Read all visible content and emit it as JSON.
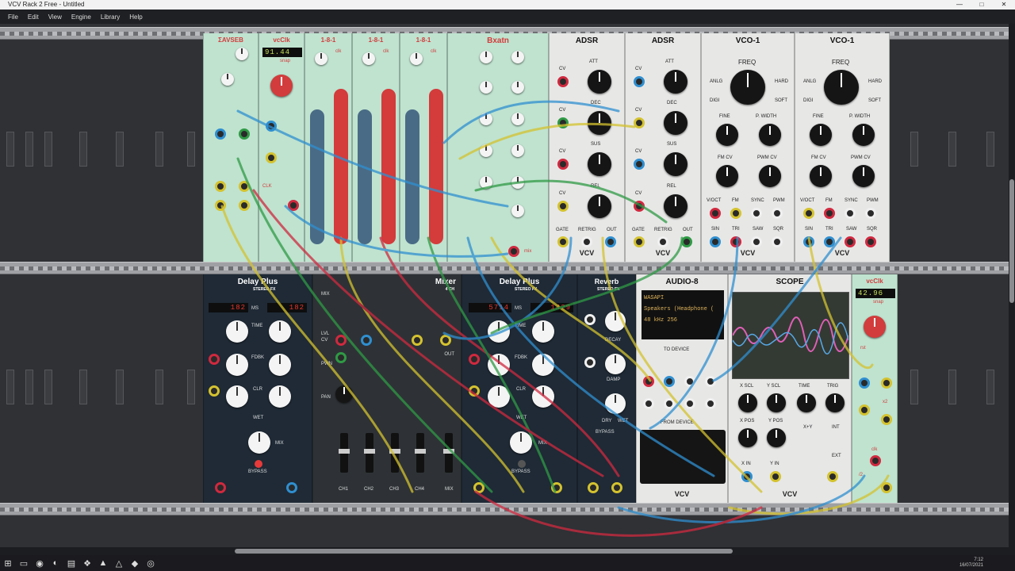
{
  "window": {
    "title": "VCV Rack 2 Free - Untitled",
    "controls": [
      "—",
      "□",
      "✕"
    ]
  },
  "menu": [
    "File",
    "Edit",
    "View",
    "Engine",
    "Library",
    "Help"
  ],
  "top_row": {
    "lfo_mod": {
      "name": "ΣAVSEB"
    },
    "clock1": {
      "name": "vcClk",
      "display": "91.44",
      "snap": "snap",
      "knob_label": "CLK"
    },
    "seq1": {
      "name": "1-8-1",
      "knob": "clk"
    },
    "seq2": {
      "name": "1-8-1",
      "knob": "clk"
    },
    "seq3": {
      "name": "1-8-1",
      "knob": "clk"
    },
    "bxatn": {
      "name": "Bxatn",
      "mix": "mix"
    },
    "adsr1": {
      "name": "ADSR",
      "labels": [
        "ATT",
        "DEC",
        "SUS",
        "REL",
        "CV",
        "CV",
        "CV",
        "CV",
        "GATE",
        "RETRIG",
        "OUT"
      ],
      "logo": "VCV"
    },
    "adsr2": {
      "name": "ADSR",
      "labels": [
        "ATT",
        "DEC",
        "SUS",
        "REL",
        "CV",
        "CV",
        "CV",
        "CV",
        "GATE",
        "RETRIG",
        "OUT"
      ],
      "logo": "VCV"
    },
    "vco1": {
      "name": "VCO-1",
      "freq": "FREQ",
      "anlg": "ANLG",
      "digi": "DIGI",
      "hard": "HARD",
      "soft": "SOFT",
      "fine": "FINE",
      "pwidth": "P. WIDTH",
      "fmcv": "FM CV",
      "pwmcv": "PWM CV",
      "jacks": [
        "V/OCT",
        "FM",
        "SYNC",
        "PWM",
        "SIN",
        "TRI",
        "SAW",
        "SQR"
      ],
      "logo": "VCV"
    },
    "vco2": {
      "name": "VCO-1",
      "freq": "FREQ",
      "anlg": "ANLG",
      "digi": "DIGI",
      "hard": "HARD",
      "soft": "SOFT",
      "fine": "FINE",
      "pwidth": "P. WIDTH",
      "fmcv": "FM CV",
      "pwmcv": "PWM CV",
      "jacks": [
        "V/OCT",
        "FM",
        "SYNC",
        "PWM",
        "SIN",
        "TRI",
        "SAW",
        "SQR"
      ],
      "logo": "VCV"
    }
  },
  "bottom_row": {
    "delay1": {
      "name": "Delay Plus",
      "sub": "STEREO FX",
      "display_l": "182",
      "ms": "MS",
      "display_r": "182",
      "time": "TIME",
      "fdbk": "FDBK",
      "clr": "CLR",
      "wet": "WET",
      "mix": "MIX",
      "bypass": "BYPASS"
    },
    "mixer": {
      "name": "Mixer",
      "sub": "4 CH",
      "mix": "MIX",
      "lvl": "LVL",
      "cv": "CV",
      "pan": "PAN",
      "pwn": "PWN",
      "out": "OUT",
      "channels": [
        "CH1",
        "CH2",
        "CH3",
        "CH4",
        "MIX"
      ]
    },
    "delay2": {
      "name": "Delay Plus",
      "sub": "STEREO FX",
      "display_l": "5714",
      "ms": "MS",
      "display_r": "1429",
      "time": "TIME",
      "fdbk": "FDBK",
      "clr": "CLR",
      "wet": "WET",
      "mix": "MIX",
      "bypass": "BYPASS"
    },
    "reverb": {
      "name": "Reverb",
      "sub": "STEREO FX",
      "decay": "DECAY",
      "damp": "DAMP",
      "dry": "DRY",
      "wet": "WET",
      "bypass": "BYPASS"
    },
    "audio8": {
      "name": "AUDIO-8",
      "lines": [
        "WASAPI",
        "Speakers (Headphone (",
        "48 kHz       256"
      ],
      "to_device": "TO DEVICE",
      "from_device": "FROM DEVICE",
      "logo": "VCV"
    },
    "scope": {
      "name": "SCOPE",
      "xscl": "X SCL",
      "yscl": "Y SCL",
      "time": "TIME",
      "trig": "TRIG",
      "xpos": "X POS",
      "ypos": "Y POS",
      "xy": "X+Y",
      "int": "INT",
      "ext": "EXT",
      "xin": "X IN",
      "yin": "Y IN",
      "logo": "VCV"
    },
    "clock2": {
      "name": "vcClk",
      "display": "42.96",
      "snap": "snap",
      "rst": "rst",
      "clk": "clk",
      "x2": "x2",
      "div2": "/2"
    }
  },
  "tray": {
    "time": "7:12",
    "date": "16/07/2021"
  },
  "colors": {
    "rail": "#9ea0a3",
    "wire_red": "#d0293f",
    "wire_green": "#2f9a45",
    "wire_blue": "#2f8fd0",
    "wire_yellow": "#d4c22f"
  }
}
